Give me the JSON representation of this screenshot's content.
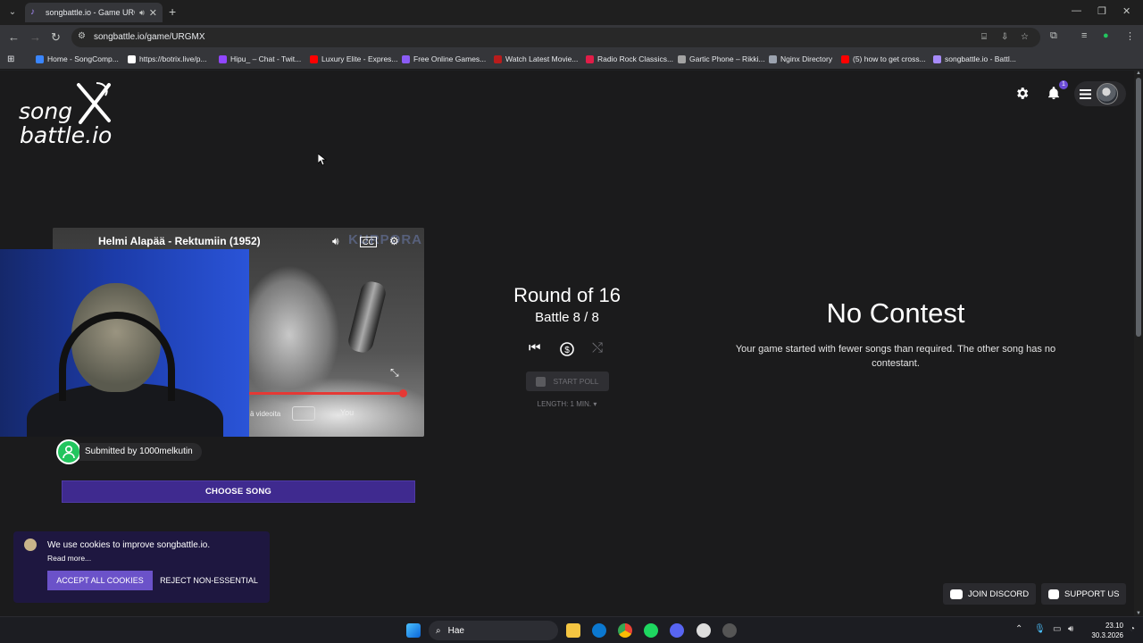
{
  "browser": {
    "tab_title": "songbattle.io - Game URGM",
    "url": "songbattle.io/game/URGMX",
    "bookmarks": [
      {
        "label": "Home - SongComp...",
        "color": "#3a86ff"
      },
      {
        "label": "https://botrix.live/p...",
        "color": "#ffffff"
      },
      {
        "label": "Hipu_ – Chat - Twit...",
        "color": "#9146ff"
      },
      {
        "label": "Luxury Elite - Expres...",
        "color": "#ff0000"
      },
      {
        "label": "Free Online Games...",
        "color": "#8b5cf6"
      },
      {
        "label": "Watch Latest Movie...",
        "color": "#b91c1c"
      },
      {
        "label": "Radio Rock Classics...",
        "color": "#e11d48"
      },
      {
        "label": "Gartic Phone – Rikki...",
        "color": "#a3a3a3"
      },
      {
        "label": "Nginx Directory",
        "color": "#9ca3af"
      },
      {
        "label": "(5) how to get cross...",
        "color": "#ff0000"
      },
      {
        "label": "songbattle.io - Battl...",
        "color": "#a78bfa"
      }
    ]
  },
  "site": {
    "logo_line1": "song",
    "logo_line2": "battle.io",
    "notification_count": "1"
  },
  "player": {
    "song_title": "Helmi Alapää - Rektumiin (1952)",
    "watermark": "KURPORA",
    "more_videos_text": "ä videoita",
    "youtube_label": "You",
    "submitted_by": "Submitted by 1000melkutin",
    "choose_song_label": "CHOOSE SONG",
    "progress_fraction": 0.95
  },
  "battle": {
    "round": "Round of 16",
    "battle": "Battle 8 / 8",
    "start_poll_label": "START POLL",
    "length_label": "LENGTH: 1 MIN. ▾"
  },
  "opponent": {
    "heading": "No Contest",
    "message": "Your game started with fewer songs than required. The other song has no contestant."
  },
  "cookies": {
    "message": "We use cookies to improve songbattle.io.",
    "read_more": "Read more...",
    "accept_label": "ACCEPT ALL COOKIES",
    "reject_label": "REJECT NON-ESSENTIAL"
  },
  "footer": {
    "discord_label": "JOIN DISCORD",
    "support_label": "SUPPORT US"
  },
  "taskbar": {
    "search_placeholder": "Hae",
    "time": "23.10",
    "date": "30.3.2026"
  }
}
